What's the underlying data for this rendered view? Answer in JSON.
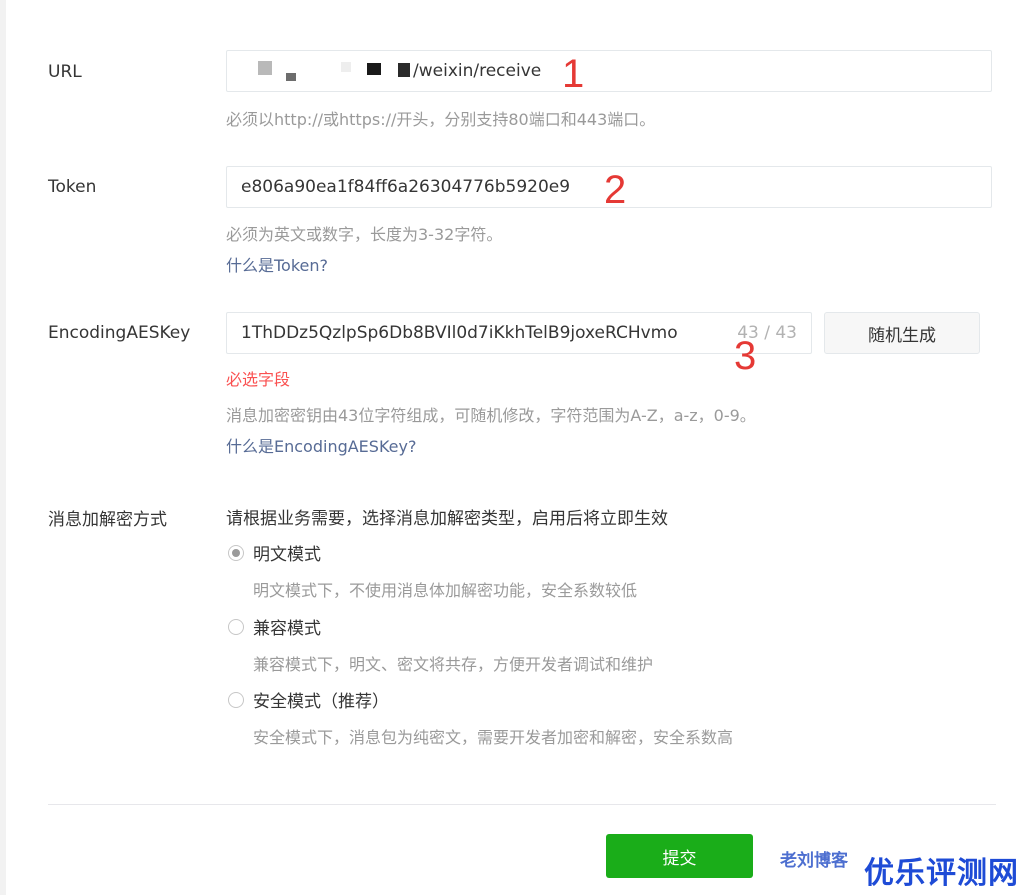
{
  "url": {
    "label": "URL",
    "value_suffix": "/weixin/receive",
    "hint": "必须以http://或https://开头，分别支持80端口和443端口。",
    "annotation": "1"
  },
  "token": {
    "label": "Token",
    "value": "e806a90ea1f84ff6a26304776b5920e9",
    "hint": "必须为英文或数字，长度为3-32字符。",
    "help_link": "什么是Token?",
    "annotation": "2"
  },
  "aes_key": {
    "label": "EncodingAESKey",
    "value": "1ThDDz5QzlpSp6Db8BVIl0d7iKkhTelB9joxeRCHvmo",
    "counter": "43 / 43",
    "generate_button": "随机生成",
    "required_error": "必选字段",
    "hint": "消息加密密钥由43位字符组成，可随机修改，字符范围为A-Z，a-z，0-9。",
    "help_link": "什么是EncodingAESKey?",
    "annotation": "3"
  },
  "encryption": {
    "label": "消息加解密方式",
    "intro": "请根据业务需要，选择消息加解密类型，启用后将立即生效",
    "options": [
      {
        "label": "明文模式",
        "desc": "明文模式下，不使用消息体加解密功能，安全系数较低",
        "selected": true
      },
      {
        "label": "兼容模式",
        "desc": "兼容模式下，明文、密文将共存，方便开发者调试和维护",
        "selected": false
      },
      {
        "label": "安全模式（推荐）",
        "desc": "安全模式下，消息包为纯密文，需要开发者加密和解密，安全系数高",
        "selected": false
      }
    ]
  },
  "footer": {
    "submit_label": "提交",
    "watermark_small": "老刘博客",
    "watermark_big": "优乐评测网"
  },
  "colors": {
    "primary_green": "#1aad19",
    "link_blue": "#576b95",
    "error_red": "#fa5151",
    "annotation_red": "#e53935"
  }
}
